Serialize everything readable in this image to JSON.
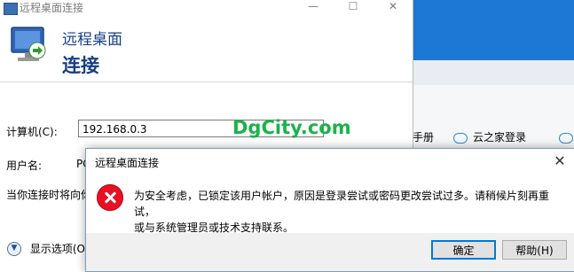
{
  "rdc": {
    "title": "远程桌面连接",
    "header_line1": "远程桌面",
    "header_line2": "连接",
    "computer_label": "计算机(C):",
    "computer_value": "192.168.0.3",
    "username_label": "用户名:",
    "username_value_partial": "PC",
    "info_partial": "当你连接时将向你",
    "options_label": "显示选项(O)",
    "window_controls": [
      "—",
      "☐",
      "✕"
    ]
  },
  "watermark": "DgCity.com",
  "background_app": {
    "bookmarks": [
      "码手册",
      "云之家登录",
      "智"
    ]
  },
  "dialog": {
    "title": "远程桌面连接",
    "message_line1": "为安全考虑，已锁定该用户帐户，原因是登录尝试或密码更改尝试过多。请稍候片刻再重试，",
    "message_line2": "或与系统管理员或技术支持联系。",
    "ok_label": "确定",
    "help_label": "帮助(H)",
    "close_glyph": "✕"
  },
  "colors": {
    "header_text": "#173f86",
    "watermark": "#19b34a",
    "error_icon": "#e81123",
    "background_app_blue": "#1d77d4"
  },
  "icons": [
    "remote-desktop-icon",
    "error-icon",
    "expand-options-icon",
    "cloud-icon",
    "close-icon"
  ]
}
